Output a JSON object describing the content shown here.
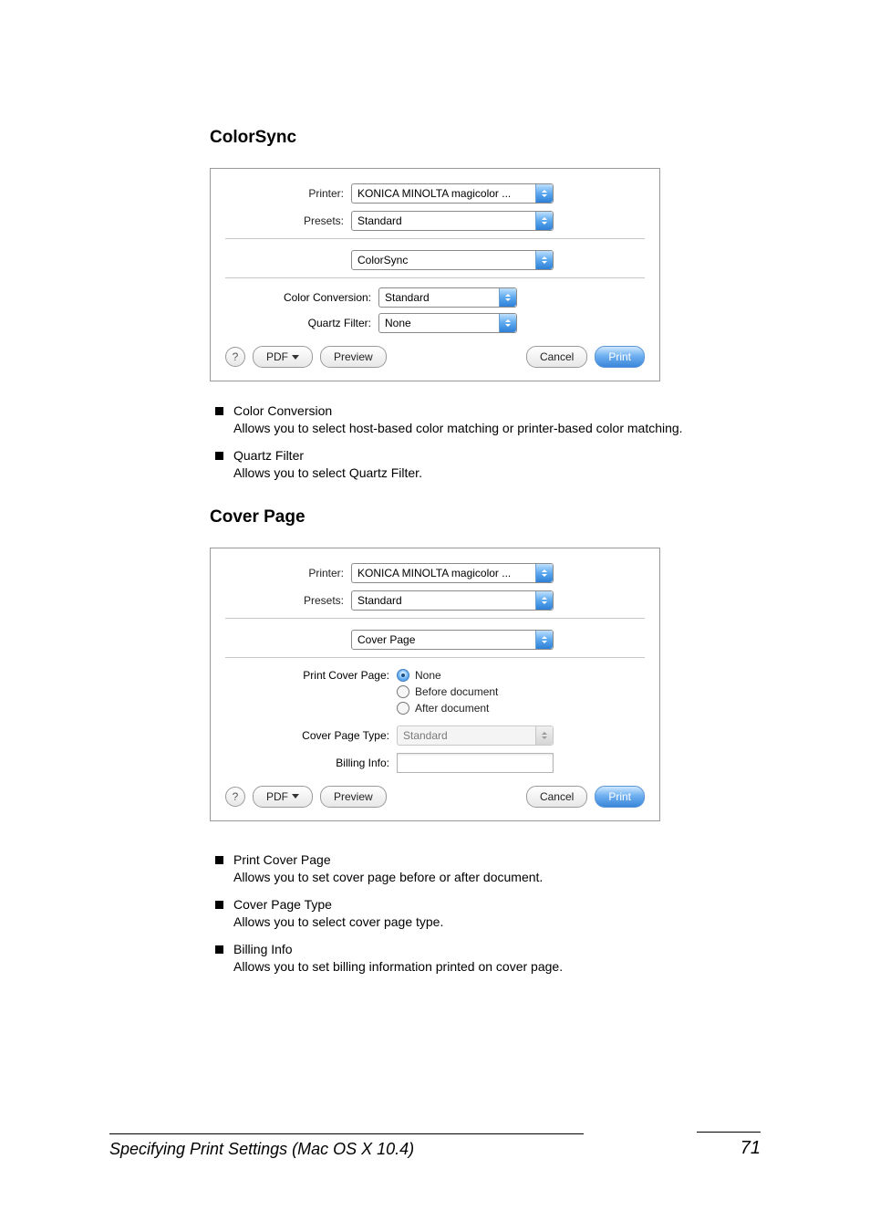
{
  "sections": {
    "colorsync": {
      "heading": "ColorSync",
      "dialog": {
        "printer_label": "Printer:",
        "printer_value": "KONICA MINOLTA magicolor ...",
        "presets_label": "Presets:",
        "presets_value": "Standard",
        "panel_value": "ColorSync",
        "color_conversion_label": "Color Conversion:",
        "color_conversion_value": "Standard",
        "quartz_filter_label": "Quartz Filter:",
        "quartz_filter_value": "None",
        "help": "?",
        "pdf": "PDF",
        "preview": "Preview",
        "cancel": "Cancel",
        "print": "Print"
      },
      "bullets": [
        {
          "term": "Color Conversion",
          "desc": "Allows you to select host-based color matching or printer-based color matching."
        },
        {
          "term": "Quartz Filter",
          "desc": "Allows you to select Quartz Filter."
        }
      ]
    },
    "coverpage": {
      "heading": "Cover Page",
      "dialog": {
        "printer_label": "Printer:",
        "printer_value": "KONICA MINOLTA magicolor ...",
        "presets_label": "Presets:",
        "presets_value": "Standard",
        "panel_value": "Cover Page",
        "print_cover_label": "Print Cover Page:",
        "radio_none": "None",
        "radio_before": "Before document",
        "radio_after": "After document",
        "cover_type_label": "Cover Page Type:",
        "cover_type_value": "Standard",
        "billing_label": "Billing Info:",
        "help": "?",
        "pdf": "PDF",
        "preview": "Preview",
        "cancel": "Cancel",
        "print": "Print"
      },
      "bullets": [
        {
          "term": "Print Cover Page",
          "desc": "Allows you to set cover page before or after document."
        },
        {
          "term": "Cover Page Type",
          "desc": "Allows you to select cover page type."
        },
        {
          "term": "Billing Info",
          "desc": "Allows you to set billing information printed on cover page."
        }
      ]
    }
  },
  "footer": {
    "title": "Specifying Print Settings (Mac OS X 10.4)",
    "page": "71"
  }
}
